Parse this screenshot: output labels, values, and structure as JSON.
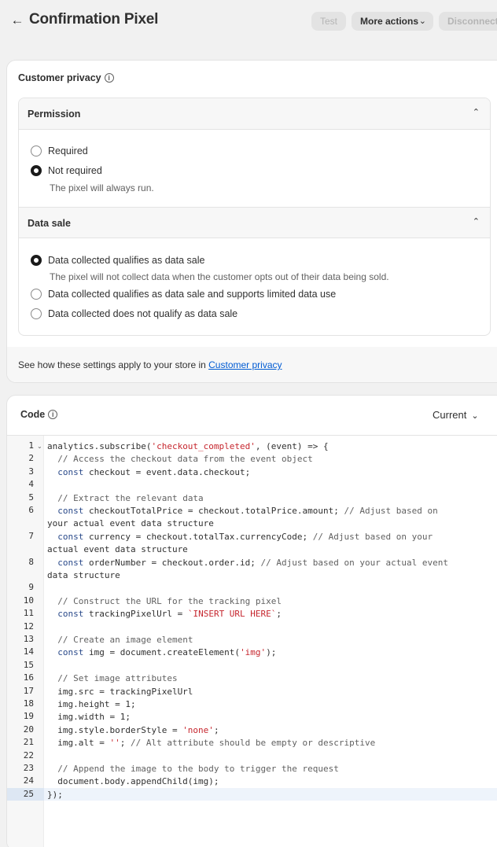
{
  "header": {
    "title": "Confirmation Pixel",
    "test_label": "Test",
    "more_actions_label": "More actions",
    "disconnect_label": "Disconnect"
  },
  "privacy": {
    "title": "Customer privacy",
    "permission": {
      "heading": "Permission",
      "options": [
        "Required",
        "Not required"
      ],
      "selected": "Not required",
      "help": "The pixel will always run."
    },
    "data_sale": {
      "heading": "Data sale",
      "options": [
        "Data collected qualifies as data sale",
        "Data collected qualifies as data sale and supports limited data use",
        "Data collected does not qualify as data sale"
      ],
      "selected": "Data collected qualifies as data sale",
      "help": "The pixel will not collect data when the customer opts out of their data being sold."
    },
    "footer_text": "See how these settings apply to your store in ",
    "footer_link": "Customer privacy"
  },
  "code": {
    "title": "Code",
    "version": "Current",
    "active_line": 25,
    "lines": [
      "analytics.subscribe('checkout_completed', (event) => {",
      "  // Access the checkout data from the event object",
      "  const checkout = event.data.checkout;",
      "",
      "  // Extract the relevant data",
      "  const checkoutTotalPrice = checkout.totalPrice.amount; // Adjust based on your actual event data structure",
      "  const currency = checkout.totalTax.currencyCode; // Adjust based on your actual event data structure",
      "  const orderNumber = checkout.order.id; // Adjust based on your actual event data structure",
      "",
      "  // Construct the URL for the tracking pixel",
      "  const trackingPixelUrl = `INSERT URL HERE`;",
      "",
      "  // Create an image element",
      "  const img = document.createElement('img');",
      "",
      "  // Set image attributes",
      "  img.src = trackingPixelUrl",
      "  img.height = 1;",
      "  img.width = 1;",
      "  img.style.borderStyle = 'none';",
      "  img.alt = ''; // Alt attribute should be empty or descriptive",
      "",
      "  // Append the image to the body to trigger the request",
      "  document.body.appendChild(img);",
      "});"
    ]
  },
  "icons": {
    "back": "arrow-left-icon",
    "chevron_down": "chevron-down-icon",
    "chevron_up": "chevron-up-icon",
    "info": "info-icon",
    "fold": "fold-caret-icon"
  },
  "colors": {
    "link": "#005bd3",
    "string": "#c6262e",
    "comment": "#616161",
    "active_line": "#eef4fb"
  }
}
